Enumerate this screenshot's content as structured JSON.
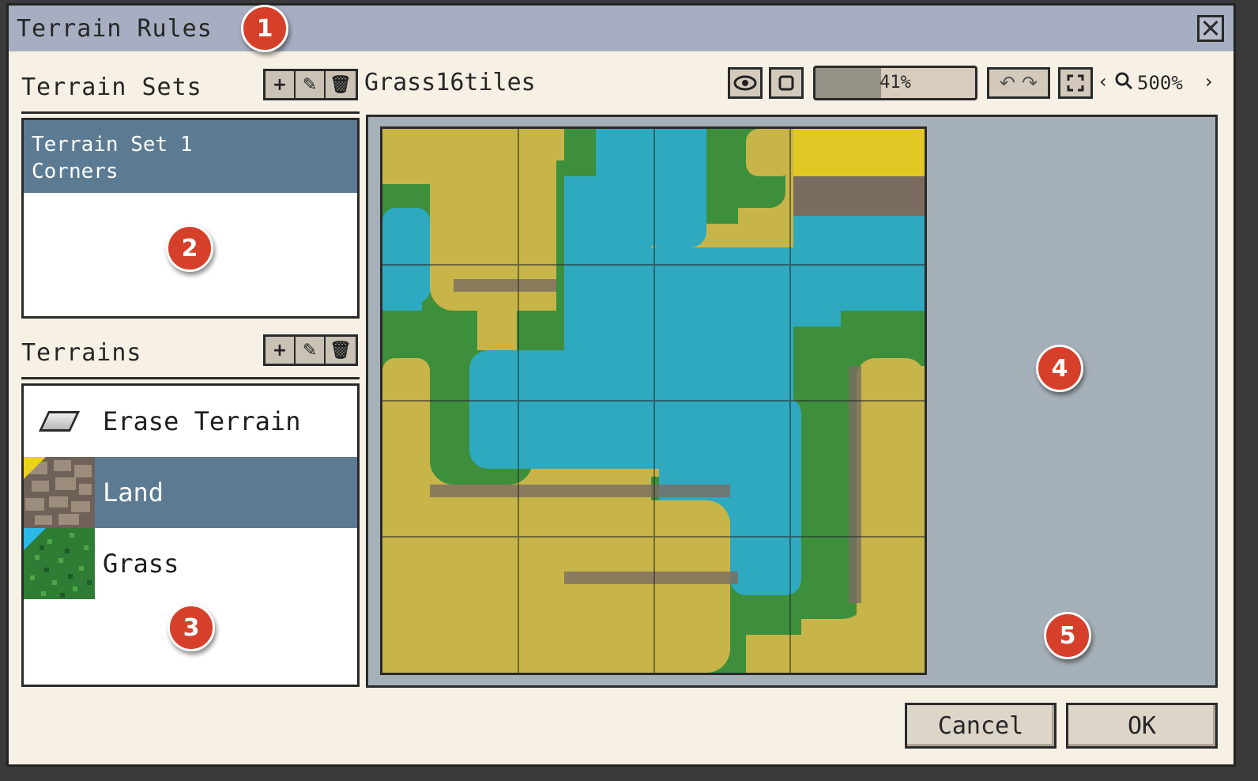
{
  "dialog": {
    "title": "Terrain Rules",
    "close_icon": "close-icon"
  },
  "callouts": [
    "1",
    "2",
    "3",
    "4",
    "5"
  ],
  "terrain_sets": {
    "label": "Terrain Sets",
    "buttons": [
      "plus-icon",
      "pencil-icon",
      "trash-icon"
    ],
    "items": [
      {
        "line1": "Terrain Set 1",
        "line2": "Corners",
        "selected": true
      }
    ]
  },
  "terrains": {
    "label": "Terrains",
    "buttons": [
      "plus-icon",
      "pencil-icon",
      "trash-icon"
    ],
    "items": [
      {
        "label": "Erase Terrain",
        "icon": "eraser-icon",
        "selected": false
      },
      {
        "label": "Land",
        "icon": "land-swatch",
        "corner_color": "#e9d21e",
        "selected": true
      },
      {
        "label": "Grass",
        "icon": "grass-swatch",
        "corner_color": "#2bb8e8",
        "selected": false
      }
    ]
  },
  "tileset": {
    "name": "Grass16tiles",
    "toolbar_icons": [
      "eye-icon",
      "stop-icon",
      "undo-icon",
      "redo-icon",
      "fit-icon",
      "chevron-left-icon",
      "zoom-icon",
      "chevron-right-icon"
    ],
    "progress_text": "41%",
    "progress_value": 0.41,
    "zoom_text": "500%"
  },
  "buttons": {
    "cancel": "Cancel",
    "ok": "OK"
  },
  "colors": {
    "selection": "#5c7b93",
    "title_bar": "#a7aec1",
    "tile_area": "#a6b0b8",
    "sand": "#c7b54a",
    "water": "#2fa9c0",
    "grass": "#3d8f3c"
  }
}
